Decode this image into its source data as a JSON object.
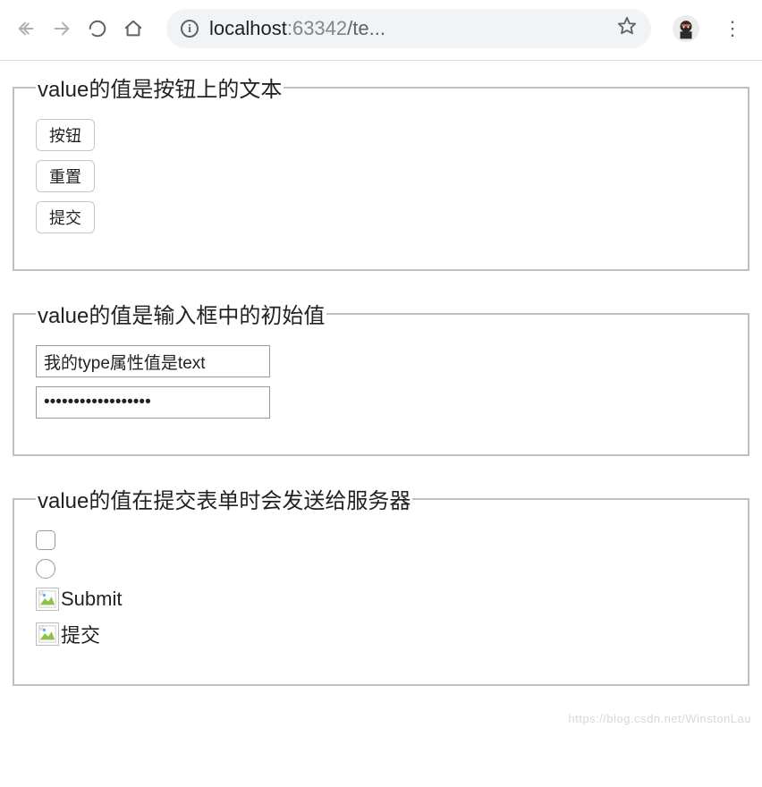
{
  "browser": {
    "url_host": "localhost",
    "url_port": ":63342",
    "url_path": "/te..."
  },
  "fieldsets": {
    "buttons": {
      "legend": "value的值是按钮上的文本",
      "items": {
        "button": "按钮",
        "reset": "重置",
        "submit": "提交"
      }
    },
    "inputs": {
      "legend": "value的值是输入框中的初始值",
      "text_value": "我的type属性值是text",
      "password_value": "我的type属性值是password"
    },
    "form_values": {
      "legend": "value的值在提交表单时会发送给服务器",
      "image_submit_en": "Submit",
      "image_submit_zh": "提交"
    }
  },
  "watermark": "https://blog.csdn.net/WinstonLau"
}
